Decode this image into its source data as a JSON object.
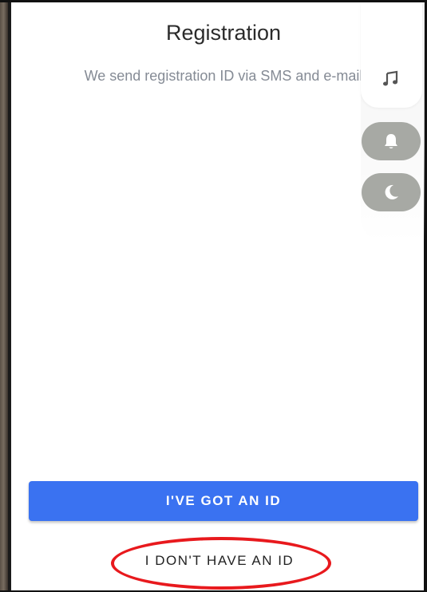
{
  "screen": {
    "title": "Registration",
    "subtitle": "We send registration ID via SMS and e-mail"
  },
  "actions": {
    "primary_label": "I'VE GOT AN ID",
    "secondary_label": "I DON'T HAVE AN ID"
  },
  "side_controls": {
    "items": [
      {
        "icon": "music-note-icon"
      },
      {
        "icon": "bell-icon"
      },
      {
        "icon": "moon-icon"
      }
    ]
  },
  "colors": {
    "primary_button": "#3a72f1",
    "highlight_ring": "#e8191d",
    "subtitle_text": "#858b95",
    "pill_background": "#a7a9a4"
  }
}
